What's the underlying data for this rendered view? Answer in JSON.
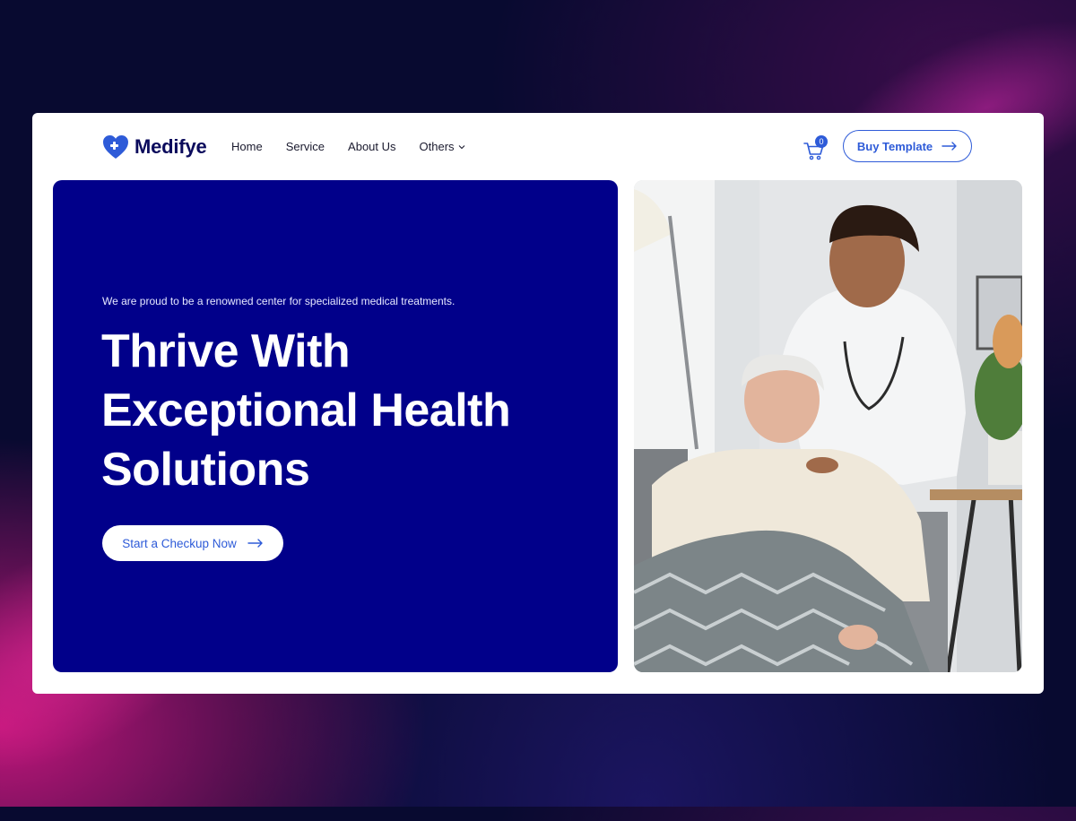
{
  "brand": {
    "name": "Medifye"
  },
  "nav": {
    "items": [
      {
        "label": "Home"
      },
      {
        "label": "Service"
      },
      {
        "label": "About Us"
      },
      {
        "label": "Others"
      }
    ]
  },
  "cart": {
    "count": "0"
  },
  "header_button": {
    "label": "Buy Template"
  },
  "hero": {
    "tagline": "We are proud to be a renowned center for specialized medical treatments.",
    "headline_lines": [
      "Thrive With",
      "Exceptional Health",
      "Solutions"
    ],
    "cta_label": "Start a Checkup Now"
  },
  "colors": {
    "brand_blue": "#2e5bd8",
    "hero_bg": "#01008a",
    "logo_text": "#0b0b5c",
    "page_bg": "#080a30"
  },
  "icons": {
    "logo": "heart-cross-icon",
    "cart": "cart-icon",
    "dropdown": "chevron-down-icon",
    "arrow": "arrow-right-icon"
  }
}
